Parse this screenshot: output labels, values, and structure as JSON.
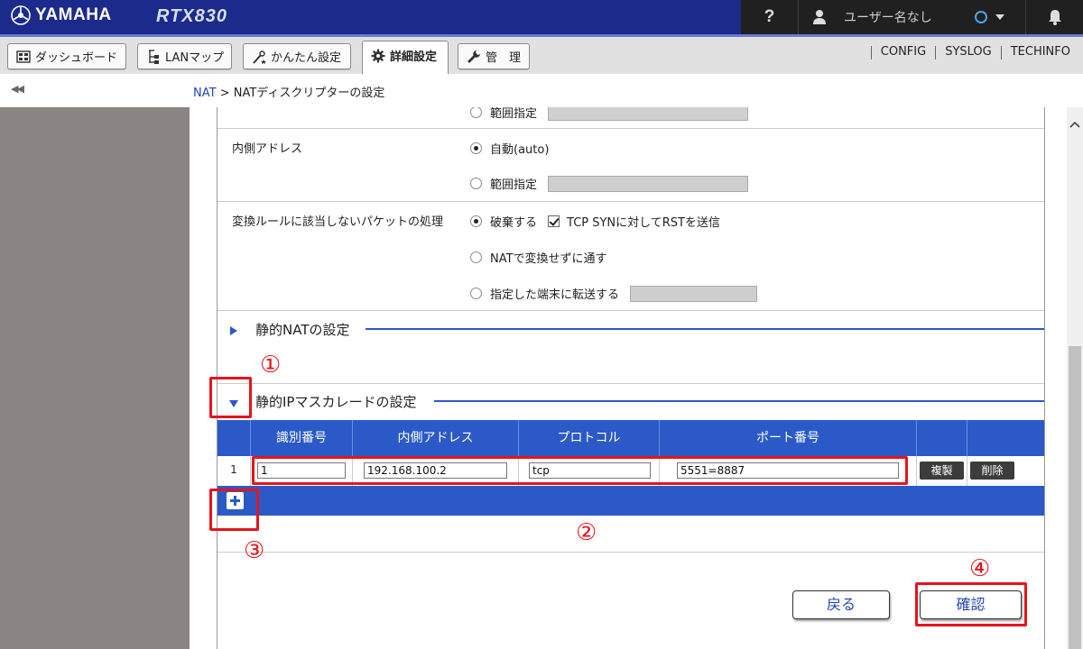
{
  "header": {
    "brand": "YAMAHA",
    "model": "RTX830",
    "help_label": "?",
    "user_label": "ユーザー名なし",
    "colors": {
      "brand_bar": "#1c2a8c",
      "right_panel": "#202020"
    }
  },
  "tabs": [
    {
      "label": "ダッシュボード",
      "icon": "dashboard-icon"
    },
    {
      "label": "LANマップ",
      "icon": "lan-map-icon"
    },
    {
      "label": "かんたん設定",
      "icon": "wand-icon"
    },
    {
      "label": "詳細設定",
      "icon": "gear-icon",
      "active": true
    },
    {
      "label": "管　理",
      "icon": "wrench-icon"
    }
  ],
  "top_links": [
    "CONFIG",
    "SYSLOG",
    "TECHINFO"
  ],
  "breadcrumb": {
    "root": "NAT",
    "separator": ">",
    "current": "NATディスクリプターの設定"
  },
  "form": {
    "prev_partial_option": "範囲指定",
    "inner_address": {
      "label": "内側アドレス",
      "options": [
        "自動(auto)",
        "範囲指定"
      ],
      "selected": "自動(auto)"
    },
    "unmatched_packets": {
      "label": "変換ルールに該当しないパケットの処理",
      "options": [
        "破棄する",
        "NATで変換せずに通す",
        "指定した端末に転送する"
      ],
      "selected": "破棄する",
      "checkbox_label": "TCP SYNに対してRSTを送信",
      "checkbox_checked": true
    }
  },
  "sections": {
    "static_nat": "静的NATの設定",
    "static_masq": "静的IPマスカレードの設定"
  },
  "table": {
    "headers": [
      "識別番号",
      "内側アドレス",
      "プロトコル",
      "ポート番号"
    ],
    "rows": [
      {
        "index": "1",
        "id": "1",
        "inner_address": "192.168.100.2",
        "protocol": "tcp",
        "port": "5551=8887",
        "copy_label": "複製",
        "delete_label": "削除"
      }
    ]
  },
  "buttons": {
    "back": "戻る",
    "confirm": "確認"
  },
  "annotations": {
    "m1": "①",
    "m2": "②",
    "m3": "③",
    "m4": "④",
    "color": "#e5141c"
  }
}
